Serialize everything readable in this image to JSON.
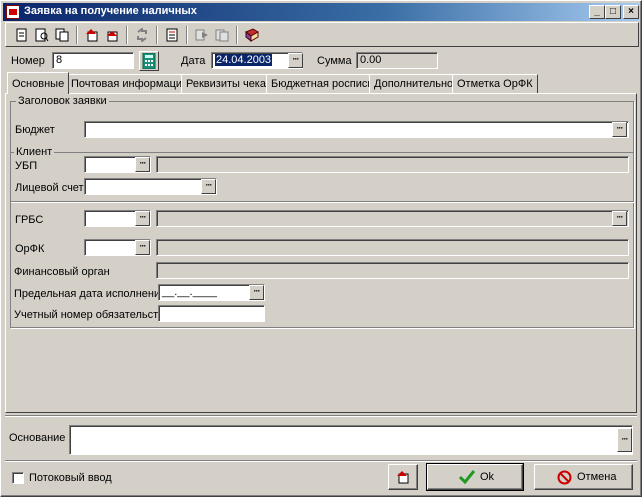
{
  "window": {
    "title": "Заявка на получение наличных",
    "minimize_glyph": "_",
    "maximize_glyph": "□",
    "close_glyph": "×"
  },
  "header": {
    "number_label": "Номер",
    "number_value": "8",
    "date_label": "Дата",
    "date_value": "24.04.2003",
    "sum_label": "Сумма",
    "sum_value": "0.00"
  },
  "tabs": [
    {
      "label": "Основные"
    },
    {
      "label": "Почтовая информация"
    },
    {
      "label": "Реквизиты чека"
    },
    {
      "label": "Бюджетная роспись"
    },
    {
      "label": "Дополнительно"
    },
    {
      "label": "Отметка ОрФК"
    }
  ],
  "main": {
    "header_group_caption": "Заголовок заявки",
    "budget_label": "Бюджет",
    "client_group_caption": "Клиент",
    "ubp_label": "УБП",
    "account_label": "Лицевой счет",
    "grbs_label": "ГРБС",
    "orfk_label": "ОрФК",
    "fin_org_label": "Финансовый орган",
    "deadline_label": "Предельная дата исполнения",
    "deadline_placeholder": "__.__.____",
    "obligation_label": "Учетный номер обязательства"
  },
  "footer": {
    "basis_label": "Основание",
    "stream_input_label": "Потоковый ввод",
    "ok_label": "Ok",
    "cancel_label": "Отмена"
  },
  "ellipsis": "···",
  "icons": {
    "toolbar": [
      "new-doc-icon",
      "preview-icon",
      "copy-doc-icon",
      "history-icon",
      "history2-icon",
      "refresh-icon",
      "properties-icon",
      "forward-icon",
      "forward2-icon",
      "book-icon"
    ],
    "calculator": "calculator-icon"
  },
  "colors": {
    "title_start": "#0a246a",
    "title_end": "#a6caf0",
    "face": "#d4d0c8",
    "selection": "#0a246a",
    "ok_check": "#1f9a1f",
    "cancel_red": "#cc0000"
  }
}
